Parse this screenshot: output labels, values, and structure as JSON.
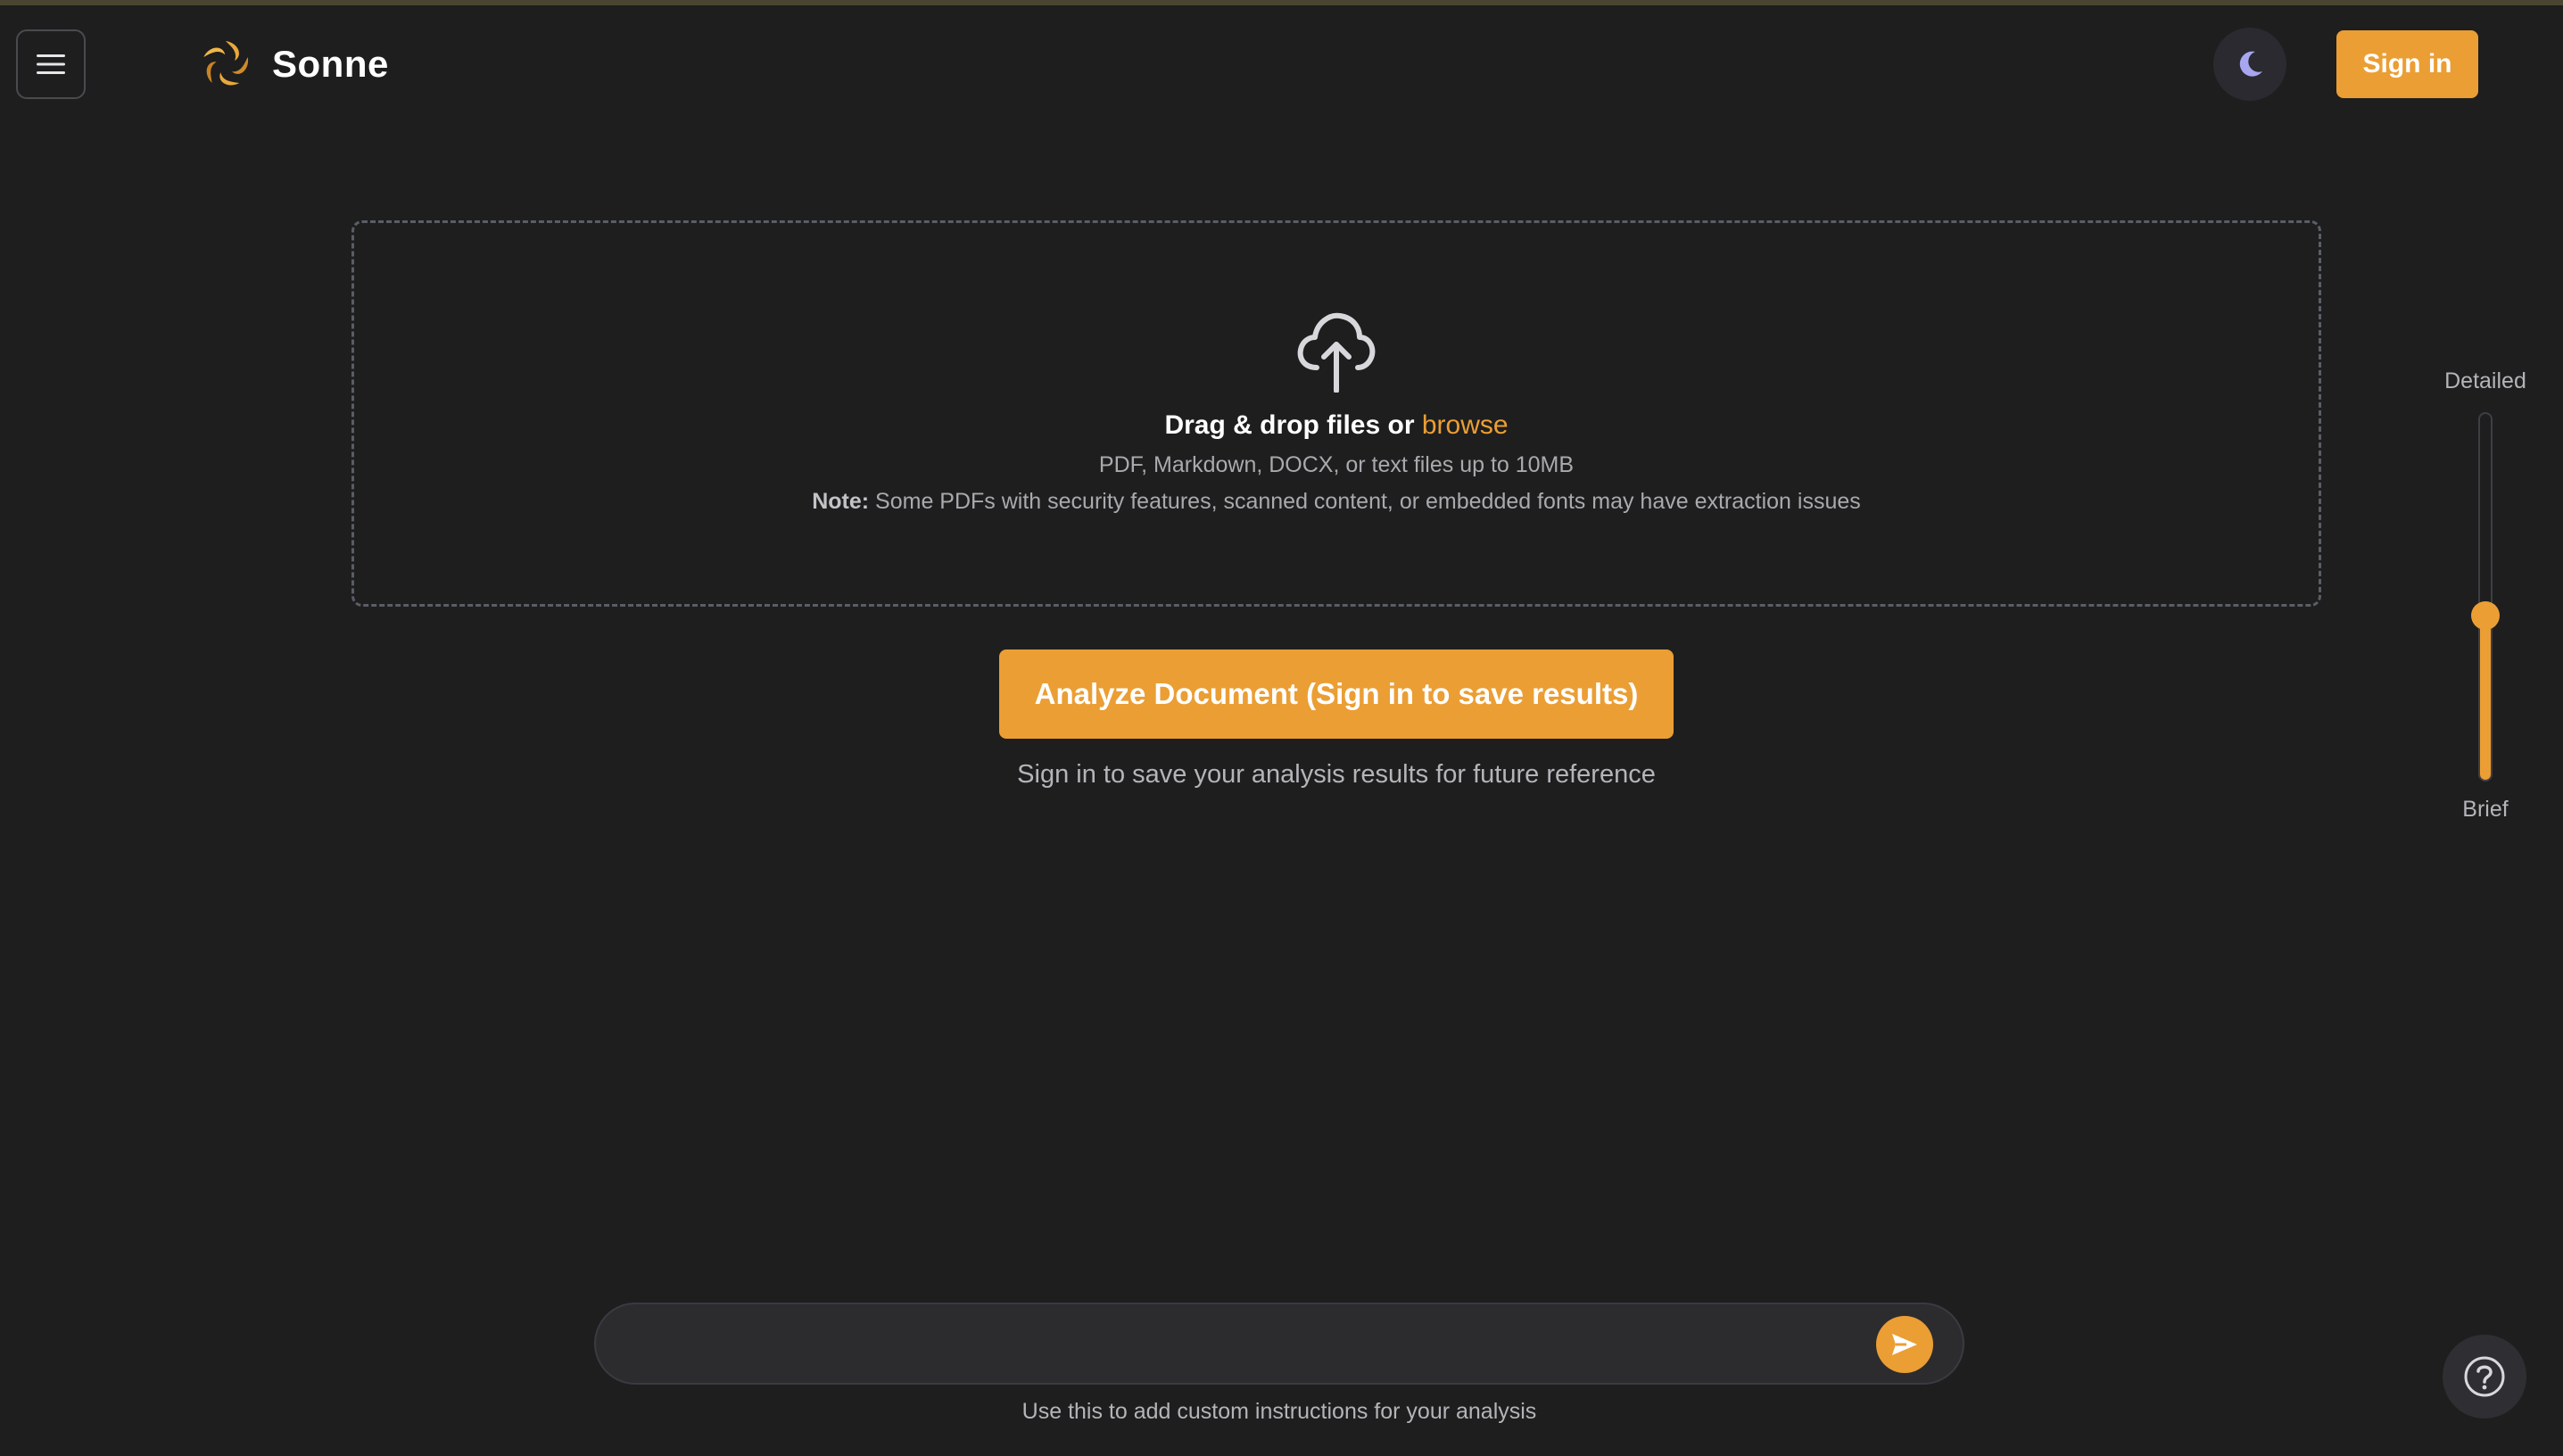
{
  "header": {
    "brand_name": "Sonne",
    "signin_label": "Sign in"
  },
  "upload": {
    "title": "Drag & drop files or ",
    "browse_label": "browse",
    "formats": "PDF, Markdown, DOCX, or text files up to 10MB",
    "note_label": "Note:",
    "note_text": " Some PDFs with security features, scanned content, or embedded fonts may have extraction issues"
  },
  "analyze": {
    "button_label": "Analyze Document (Sign in to save results)",
    "hint": "Sign in to save your analysis results for future reference"
  },
  "detail_slider": {
    "top_label": "Detailed",
    "bottom_label": "Brief",
    "level_percent": 45
  },
  "prompt": {
    "value": "",
    "hint": "Use this to add custom instructions for your analysis"
  },
  "colors": {
    "accent": "#eb9e34",
    "background": "#1e1e1e",
    "surface": "#2c2c2e",
    "muted_text": "#a9a9ae"
  },
  "icons": {
    "menu": "hamburger-icon",
    "logo": "sun-swirl-logo",
    "theme": "moon-icon",
    "upload": "cloud-upload-icon",
    "send": "send-arrow-icon",
    "help": "question-mark-icon"
  }
}
